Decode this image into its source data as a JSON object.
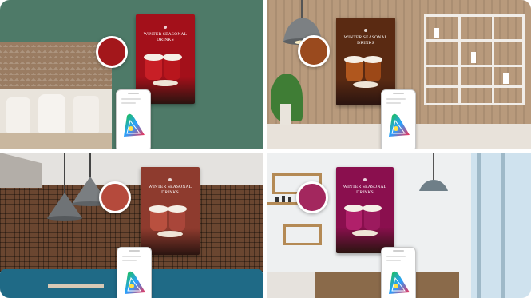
{
  "panels": [
    {
      "scene": "green-wall-cafe",
      "poster": {
        "title": "WINTER SEASONAL DRINKS",
        "tagline": "",
        "color": "#a3101a"
      },
      "swatch_color": "#a3171b",
      "phone_screen": "color-gamut-diagram"
    },
    {
      "scene": "wood-wall-shelves",
      "poster": {
        "title": "WINTER SEASONAL DRINKS",
        "tagline": "",
        "color": "#5a2a12"
      },
      "swatch_color": "#9a4a1e",
      "phone_screen": "color-gamut-diagram"
    },
    {
      "scene": "brick-wall-booths",
      "poster": {
        "title": "WINTER SEASONAL DRINKS",
        "tagline": "",
        "color": "#8e3b2e"
      },
      "swatch_color": "#b54a3c",
      "phone_screen": "color-gamut-diagram"
    },
    {
      "scene": "white-wall-shelf",
      "poster": {
        "title": "WINTER SEASONAL DRINKS",
        "tagline": "",
        "color": "#8a0f4e"
      },
      "swatch_color": "#a3275e",
      "phone_screen": "color-gamut-diagram"
    }
  ],
  "icons": {
    "swatch": "color-swatch-icon",
    "phone": "smartphone-icon",
    "gamut": "color-gamut-icon",
    "lamp": "pendant-lamp-icon"
  }
}
